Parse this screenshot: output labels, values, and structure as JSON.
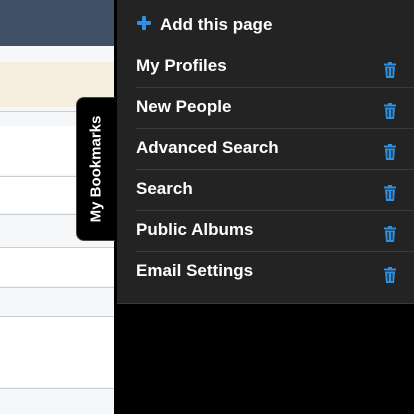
{
  "page": {
    "header_color": "#3f4f66",
    "highlight_color": "#f5eddd"
  },
  "bookmarks_tab": {
    "label": "My Bookmarks"
  },
  "drawer": {
    "add_label": "Add this page",
    "add_icon": "plus-icon",
    "accent_color": "#2f8fe0",
    "items": [
      {
        "label": "My Profiles",
        "icon": "trash-icon"
      },
      {
        "label": "New People",
        "icon": "trash-icon"
      },
      {
        "label": "Advanced Search",
        "icon": "trash-icon"
      },
      {
        "label": "Search",
        "icon": "trash-icon"
      },
      {
        "label": "Public Albums",
        "icon": "trash-icon"
      },
      {
        "label": "Email Settings",
        "icon": "trash-icon"
      }
    ]
  }
}
